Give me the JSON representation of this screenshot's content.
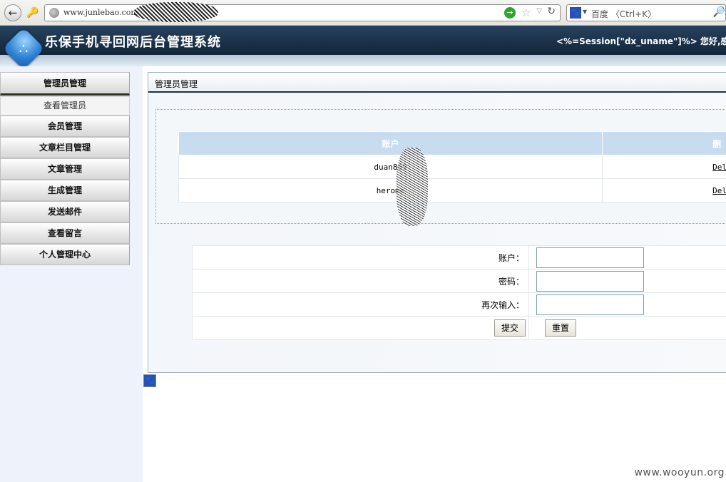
{
  "browser": {
    "url": "www.junlebao.com",
    "search_engine": "百度",
    "search_placeholder": "百度 〈Ctrl+K〉"
  },
  "header": {
    "title": "乐保手机寻回网后台管理系统",
    "session_text": "<%=Session[\"dx_uname\"]%> 您好,感谢登陆"
  },
  "sidebar": {
    "head": "管理员管理",
    "sub_item": "查看管理员",
    "items": [
      "会员管理",
      "文章栏目管理",
      "文章管理",
      "生成管理",
      "发送邮件",
      "查看留言",
      "个人管理中心"
    ]
  },
  "main": {
    "title": "管理员管理",
    "table": {
      "headers": [
        "账户",
        "删"
      ],
      "rows": [
        {
          "account": "duan869",
          "action": "Del"
        },
        {
          "account": "herome",
          "action": "Del"
        }
      ]
    },
    "form": {
      "account_label": "账户：",
      "password_label": "密码：",
      "confirm_label": "再次输入：",
      "submit_label": "提交",
      "reset_label": "重置"
    }
  },
  "watermark": "www.wooyun.org",
  "colors": {
    "header_bg": "#1c3652",
    "table_header": "#c7dcef",
    "sidebar_bg": "#eef3fb"
  },
  "icons": {
    "back": "back-arrow-icon",
    "key": "key-icon",
    "go": "go-arrow-icon",
    "star": "star-icon",
    "reload": "reload-icon",
    "baidu": "baidu-paw-icon",
    "search": "magnifier-icon",
    "logo": "share-logo-icon"
  }
}
